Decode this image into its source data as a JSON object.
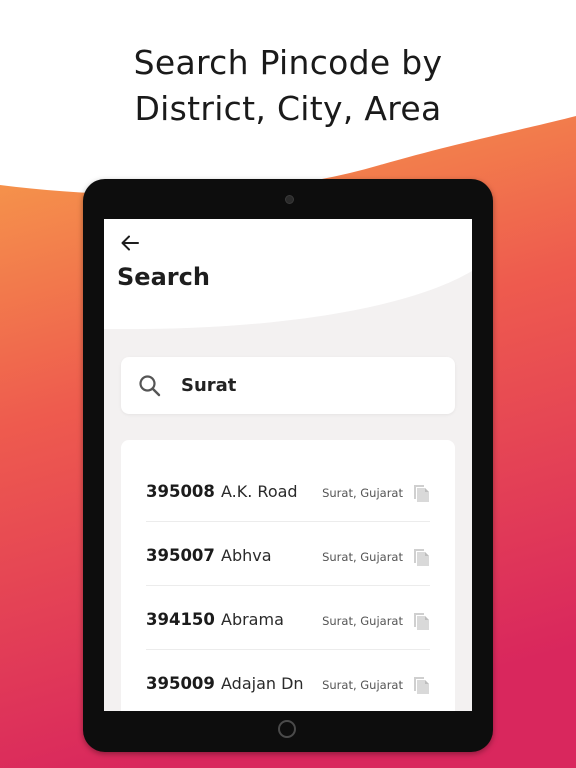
{
  "headline": {
    "line1": "Search Pincode by",
    "line2": "District, City, Area"
  },
  "colors": {
    "gradient_top": "#f7a14a",
    "gradient_mid": "#ee5b4e",
    "gradient_bottom": "#d9275d",
    "tablet_bezel": "#0d0d0d",
    "screen_bg": "#f3f1f1"
  },
  "screen": {
    "back_icon": "arrow-left-icon",
    "title": "Search",
    "search": {
      "icon": "magnifier-icon",
      "value": "Surat"
    },
    "results": [
      {
        "pincode": "395008",
        "area": "A.K. Road",
        "location": "Surat, Gujarat",
        "icon": "copy-icon"
      },
      {
        "pincode": "395007",
        "area": "Abhva",
        "location": "Surat, Gujarat",
        "icon": "copy-icon"
      },
      {
        "pincode": "394150",
        "area": "Abrama",
        "location": "Surat, Gujarat",
        "icon": "copy-icon"
      },
      {
        "pincode": "395009",
        "area": "Adajan Dn",
        "location": "Surat, Gujarat",
        "icon": "copy-icon"
      }
    ]
  }
}
